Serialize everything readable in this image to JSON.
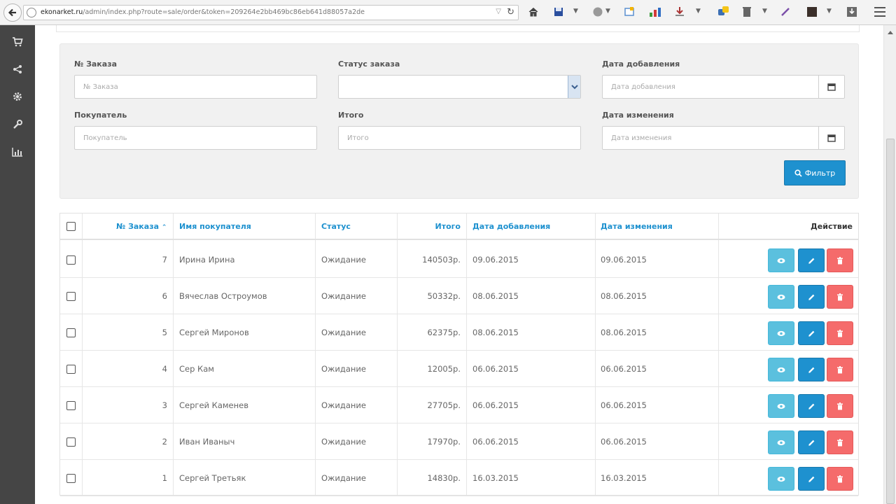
{
  "browser": {
    "url_host": "ekonarket.ru",
    "url_path": "/admin/index.php?route=sale/order&token=209264e2bb469bc86eb641d88057a2de"
  },
  "filter": {
    "order_id_label": "№ Заказа",
    "order_id_placeholder": "№ Заказа",
    "status_label": "Статус заказа",
    "status_value": "",
    "date_added_label": "Дата добавления",
    "date_added_placeholder": "Дата добавления",
    "customer_label": "Покупатель",
    "customer_placeholder": "Покупатель",
    "total_label": "Итого",
    "total_placeholder": "Итого",
    "date_modified_label": "Дата изменения",
    "date_modified_placeholder": "Дата изменения",
    "filter_button": "Фильтр"
  },
  "table": {
    "headers": {
      "order_id": "№ Заказа",
      "customer": "Имя покупателя",
      "status": "Статус",
      "total": "Итого",
      "date_added": "Дата добавления",
      "date_modified": "Дата изменения",
      "action": "Действие"
    },
    "rows": [
      {
        "id": "7",
        "customer": "Ирина Ирина",
        "status": "Ожидание",
        "total": "140503р.",
        "date_added": "09.06.2015",
        "date_modified": "09.06.2015"
      },
      {
        "id": "6",
        "customer": "Вячеслав Остроумов",
        "status": "Ожидание",
        "total": "50332р.",
        "date_added": "08.06.2015",
        "date_modified": "08.06.2015"
      },
      {
        "id": "5",
        "customer": "Сергей Миронов",
        "status": "Ожидание",
        "total": "62375р.",
        "date_added": "08.06.2015",
        "date_modified": "08.06.2015"
      },
      {
        "id": "4",
        "customer": "Сер Кам",
        "status": "Ожидание",
        "total": "12005р.",
        "date_added": "06.06.2015",
        "date_modified": "06.06.2015"
      },
      {
        "id": "3",
        "customer": "Сергей Каменев",
        "status": "Ожидание",
        "total": "27705р.",
        "date_added": "06.06.2015",
        "date_modified": "06.06.2015"
      },
      {
        "id": "2",
        "customer": "Иван Иваныч",
        "status": "Ожидание",
        "total": "17970р.",
        "date_added": "06.06.2015",
        "date_modified": "06.06.2015"
      },
      {
        "id": "1",
        "customer": "Сергей Третьяк",
        "status": "Ожидание",
        "total": "14830р.",
        "date_added": "16.03.2015",
        "date_modified": "16.03.2015"
      }
    ]
  },
  "colors": {
    "primary": "#1e91cf",
    "info": "#5bc0de",
    "danger": "#f56b6b",
    "sidebar": "#454545"
  },
  "icons": {
    "sidebar": [
      "cart-icon",
      "share-icon",
      "gear-icon",
      "wrench-icon",
      "bar-chart-icon"
    ],
    "row_actions": [
      "eye-icon",
      "pencil-icon",
      "trash-icon"
    ]
  }
}
